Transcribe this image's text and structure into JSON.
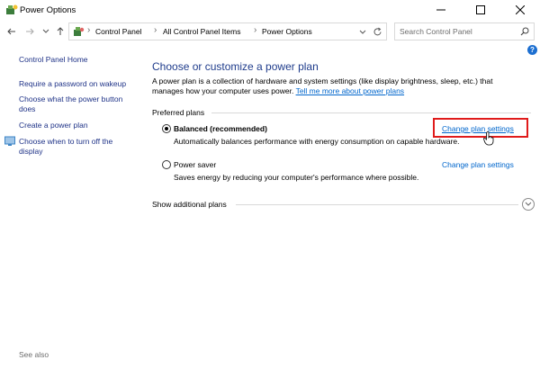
{
  "window": {
    "title": "Power Options",
    "controls": {
      "minimize_icon": "minimize-icon",
      "maximize_icon": "maximize-icon",
      "close_icon": "close-icon"
    }
  },
  "address_bar": {
    "breadcrumbs": [
      "Control Panel",
      "All Control Panel Items",
      "Power Options"
    ],
    "search_placeholder": "Search Control Panel"
  },
  "sidebar": {
    "home": "Control Panel Home",
    "items": [
      {
        "label": "Require a password on wakeup"
      },
      {
        "label": "Choose what the power button does"
      },
      {
        "label": "Create a power plan"
      },
      {
        "label": "Choose when to turn off the display"
      }
    ],
    "see_also": "See also"
  },
  "main": {
    "title": "Choose or customize a power plan",
    "description": "A power plan is a collection of hardware and system settings (like display brightness, sleep, etc.) that manages how your computer uses power.",
    "description_link": "Tell me more about power plans",
    "preferred_label": "Preferred plans",
    "plans": [
      {
        "name": "Balanced (recommended)",
        "description": "Automatically balances performance with energy consumption on capable hardware.",
        "link": "Change plan settings",
        "selected": true
      },
      {
        "name": "Power saver",
        "description": "Saves energy by reducing your computer's performance where possible.",
        "link": "Change plan settings",
        "selected": false
      }
    ],
    "additional_label": "Show additional plans"
  },
  "colors": {
    "link": "#0066cc",
    "nav_link": "#1e3287",
    "title": "#1e3b8b",
    "highlight": "#e01b1b"
  }
}
